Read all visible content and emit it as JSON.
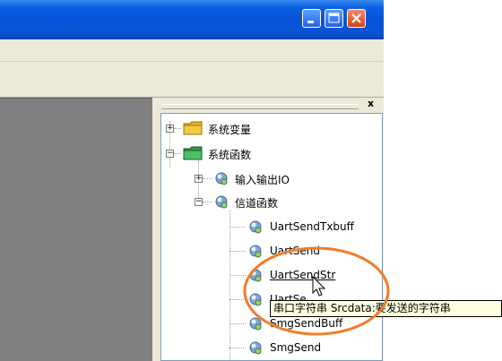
{
  "window_controls": {
    "minimize": "minimize",
    "maximize": "maximize",
    "close": "close"
  },
  "panel": {
    "close_label": "x"
  },
  "tree": {
    "nodes": [
      {
        "label": "系统变量",
        "icon": "yellow-folder-icon",
        "expanded": false
      },
      {
        "label": "系统函数",
        "icon": "green-folder-icon",
        "expanded": true
      },
      {
        "label": "输入输出IO",
        "icon": "gear-icon",
        "expanded": false
      },
      {
        "label": "信道函数",
        "icon": "gear-icon",
        "expanded": true
      },
      {
        "label": "UartSendTxbuff",
        "icon": "gear-icon"
      },
      {
        "label": "UartSend",
        "icon": "gear-icon"
      },
      {
        "label": "UartSendStr",
        "icon": "gear-icon",
        "hovered": true
      },
      {
        "label": "UartSe",
        "icon": "gear-icon"
      },
      {
        "label": "SmgSendBuff",
        "icon": "gear-icon"
      },
      {
        "label": "SmgSend",
        "icon": "gear-icon"
      }
    ]
  },
  "tooltip": {
    "text": "串口字符串 Srcdata:要发送的字符串"
  },
  "colors": {
    "highlight_ellipse": "#f07c2c",
    "tooltip_bg": "#ffffe1",
    "titlebar": "#0553d8"
  }
}
